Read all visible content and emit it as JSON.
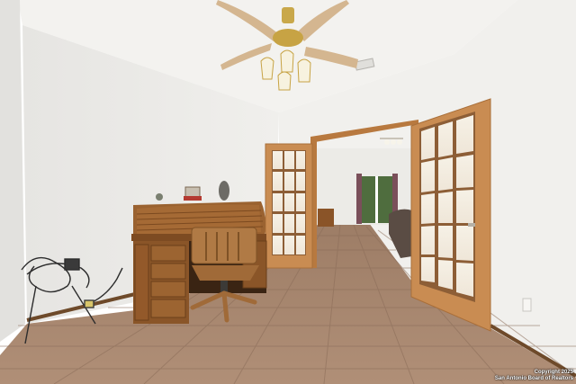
{
  "photo": {
    "subject": "interior",
    "colors": {
      "wall": "#ecebe8",
      "ceiling": "#f3f2ef",
      "floor_tile": "#a98870",
      "grout": "#8a6c58",
      "door_wood": "#c98c52",
      "desk_wood": "#8a5528",
      "baseboard": "#6e4a2a"
    }
  },
  "watermark": {
    "line1": "Copyright 2025",
    "line2": "San Antonio Board of Realtors"
  }
}
